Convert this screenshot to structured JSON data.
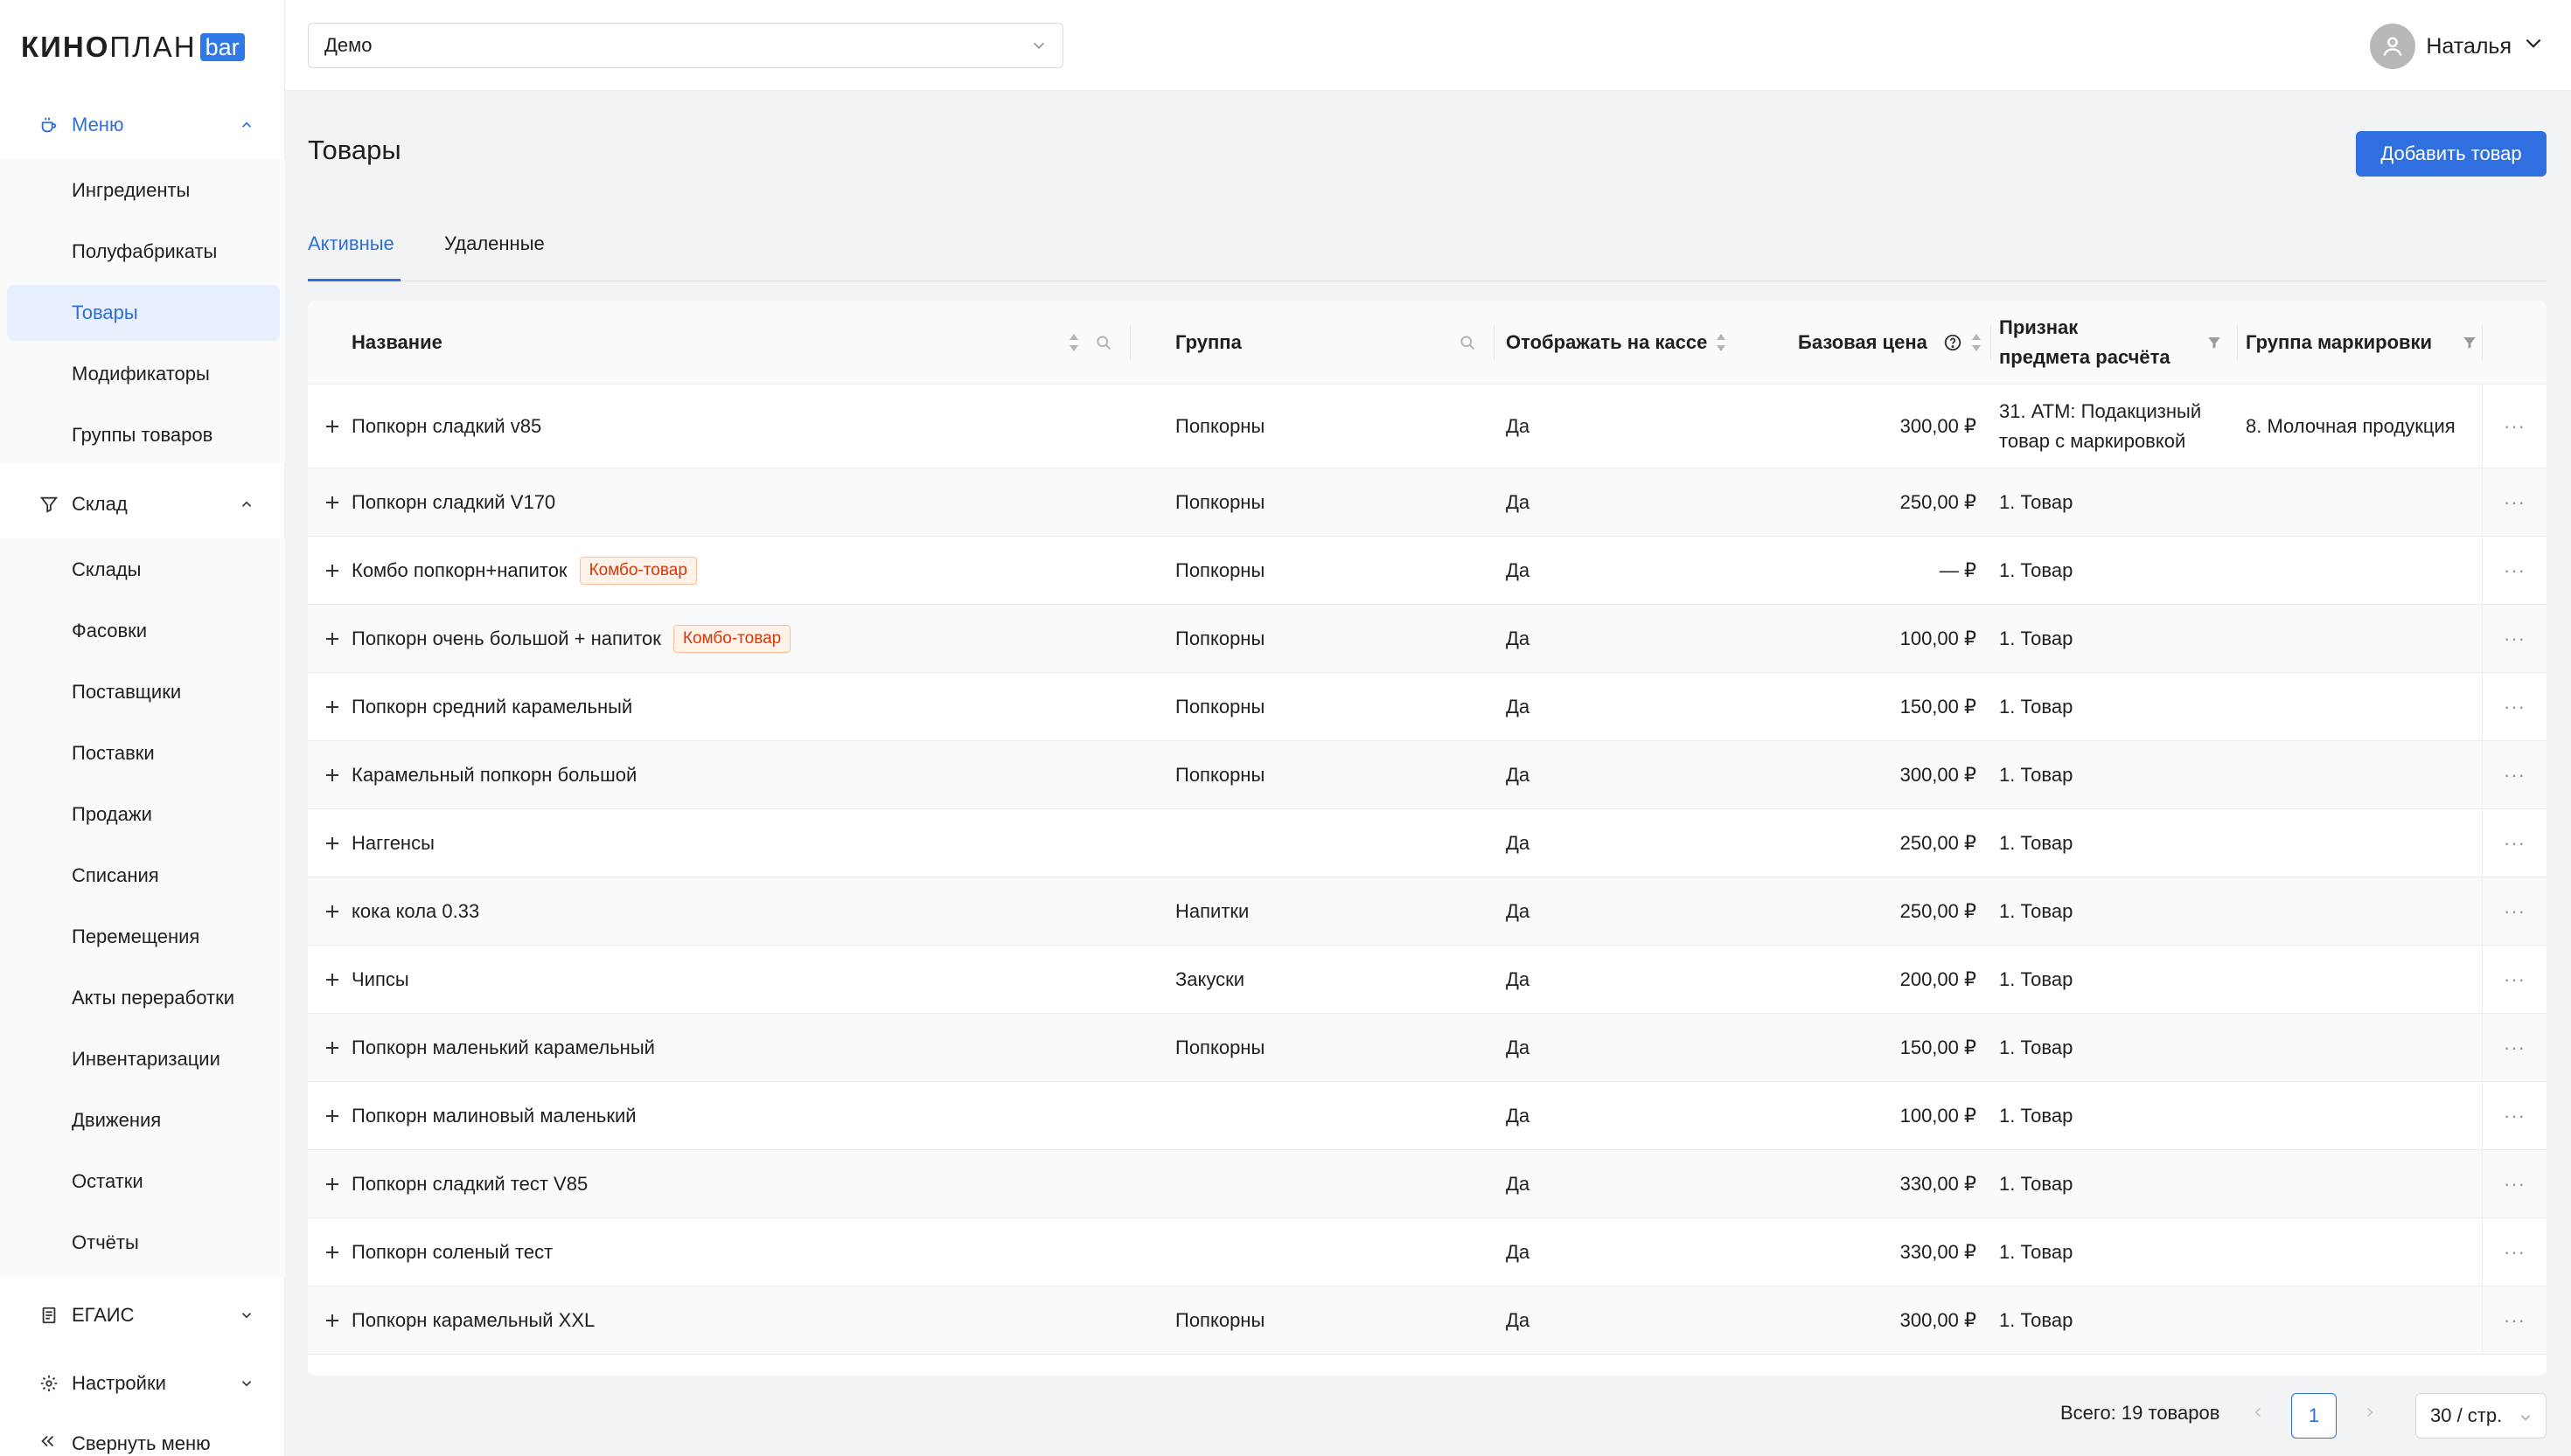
{
  "logo": {
    "text_bold": "КИНО",
    "text_regular": "ПЛАН",
    "badge": "bar"
  },
  "sidebar": {
    "menu_group": {
      "label": "Меню",
      "icon": "coffee-cup-icon",
      "expanded": true
    },
    "menu_items": [
      {
        "label": "Ингредиенты",
        "selected": false
      },
      {
        "label": "Полуфабрикаты",
        "selected": false
      },
      {
        "label": "Товары",
        "selected": true
      },
      {
        "label": "Модификаторы",
        "selected": false
      },
      {
        "label": "Группы товаров",
        "selected": false
      }
    ],
    "warehouse_group": {
      "label": "Склад",
      "icon": "funnel-icon",
      "expanded": true
    },
    "warehouse_items": [
      {
        "label": "Склады"
      },
      {
        "label": "Фасовки"
      },
      {
        "label": "Поставщики"
      },
      {
        "label": "Поставки"
      },
      {
        "label": "Продажи"
      },
      {
        "label": "Списания"
      },
      {
        "label": "Перемещения"
      },
      {
        "label": "Акты переработки"
      },
      {
        "label": "Инвентаризации"
      },
      {
        "label": "Движения"
      },
      {
        "label": "Остатки"
      },
      {
        "label": "Отчёты"
      }
    ],
    "egais_group": {
      "label": "ЕГАИС",
      "icon": "document-icon",
      "expanded": false
    },
    "settings_group": {
      "label": "Настройки",
      "icon": "gear-icon",
      "expanded": false
    },
    "collapse_label": "Свернуть меню"
  },
  "topbar": {
    "cinema_select": {
      "value": "Демо"
    },
    "user": {
      "name": "Наталья"
    }
  },
  "page": {
    "title": "Товары",
    "add_button": "Добавить товар",
    "tabs": [
      {
        "label": "Активные",
        "active": true
      },
      {
        "label": "Удаленные",
        "active": false
      }
    ]
  },
  "table": {
    "columns": {
      "name": "Название",
      "group": "Группа",
      "show_at_pos": "Отображать на кассе",
      "base_price": "Базовая цена",
      "payment_subject": "Признак предмета расчёта",
      "marking_group": "Группа маркировки"
    },
    "rows": [
      {
        "name": "Попкорн сладкий v85",
        "tag": "",
        "group": "Попкорны",
        "show": "Да",
        "price": "300,00 ₽",
        "subject": "31. АТМ: Подакцизный товар с маркировкой",
        "marking": "8. Молочная продукция"
      },
      {
        "name": "Попкорн сладкий V170",
        "tag": "",
        "group": "Попкорны",
        "show": "Да",
        "price": "250,00 ₽",
        "subject": "1. Товар",
        "marking": ""
      },
      {
        "name": "Комбо попкорн+напиток",
        "tag": "Комбо-товар",
        "group": "Попкорны",
        "show": "Да",
        "price": "— ₽",
        "subject": "1. Товар",
        "marking": ""
      },
      {
        "name": "Попкорн очень большой + напиток",
        "tag": "Комбо-товар",
        "group": "Попкорны",
        "show": "Да",
        "price": "100,00 ₽",
        "subject": "1. Товар",
        "marking": ""
      },
      {
        "name": "Попкорн средний карамельный",
        "tag": "",
        "group": "Попкорны",
        "show": "Да",
        "price": "150,00 ₽",
        "subject": "1. Товар",
        "marking": ""
      },
      {
        "name": "Карамельный попкорн большой",
        "tag": "",
        "group": "Попкорны",
        "show": "Да",
        "price": "300,00 ₽",
        "subject": "1. Товар",
        "marking": ""
      },
      {
        "name": "Наггенсы",
        "tag": "",
        "group": "",
        "show": "Да",
        "price": "250,00 ₽",
        "subject": "1. Товар",
        "marking": ""
      },
      {
        "name": "кока кола 0.33",
        "tag": "",
        "group": "Напитки",
        "show": "Да",
        "price": "250,00 ₽",
        "subject": "1. Товар",
        "marking": ""
      },
      {
        "name": "Чипсы",
        "tag": "",
        "group": "Закуски",
        "show": "Да",
        "price": "200,00 ₽",
        "subject": "1. Товар",
        "marking": ""
      },
      {
        "name": "Попкорн маленький карамельный",
        "tag": "",
        "group": "Попкорны",
        "show": "Да",
        "price": "150,00 ₽",
        "subject": "1. Товар",
        "marking": ""
      },
      {
        "name": "Попкорн малиновый маленький",
        "tag": "",
        "group": "",
        "show": "Да",
        "price": "100,00 ₽",
        "subject": "1. Товар",
        "marking": ""
      },
      {
        "name": "Попкорн сладкий тест V85",
        "tag": "",
        "group": "",
        "show": "Да",
        "price": "330,00 ₽",
        "subject": "1. Товар",
        "marking": ""
      },
      {
        "name": "Попкорн соленый тест",
        "tag": "",
        "group": "",
        "show": "Да",
        "price": "330,00 ₽",
        "subject": "1. Товар",
        "marking": ""
      },
      {
        "name": "Попкорн карамельный XXL",
        "tag": "",
        "group": "Попкорны",
        "show": "Да",
        "price": "300,00 ₽",
        "subject": "1. Товар",
        "marking": ""
      }
    ],
    "row_actions_icon": "more-icon",
    "expand_icon": "plus-icon"
  },
  "pagination": {
    "total": "Всего: 19 товаров",
    "current_page": "1",
    "page_size": "30 / стр."
  },
  "colors": {
    "accent": "#2f6fd6",
    "primary_button": "#2f6fe0",
    "tag_text": "#d4380d",
    "tag_bg": "#fff2e8"
  }
}
